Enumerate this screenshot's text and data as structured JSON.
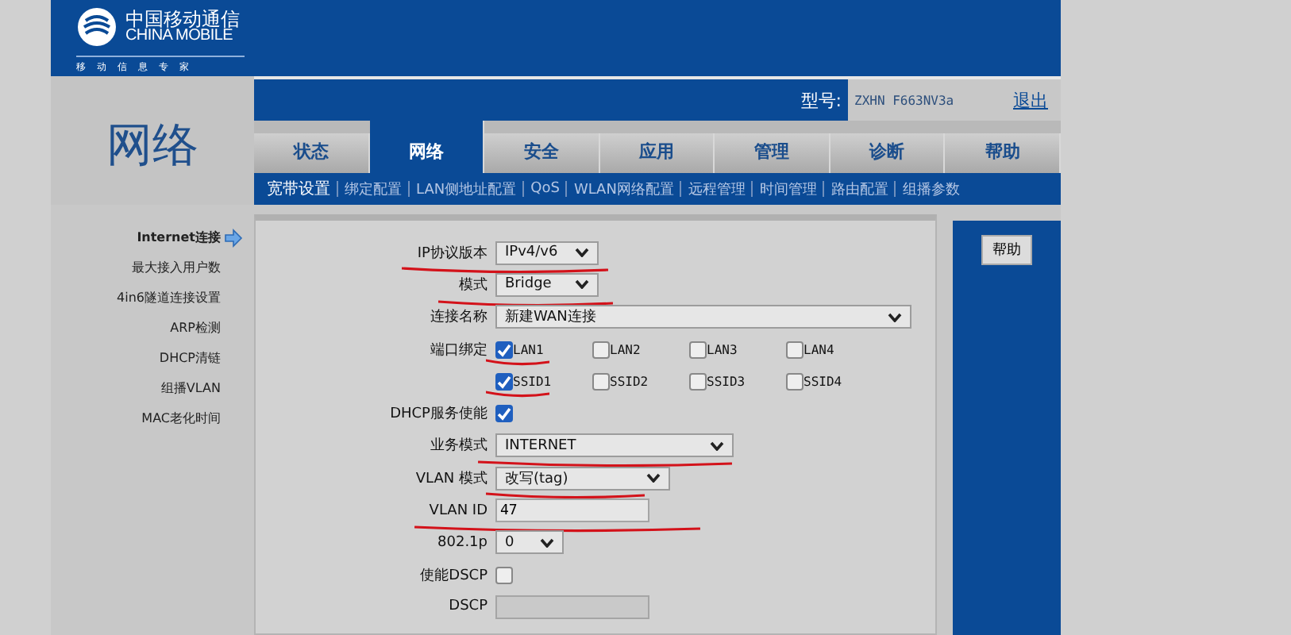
{
  "logo": {
    "name_cn": "中国移动通信",
    "name_en": "CHINA MOBILE",
    "slogan": "移动信息专家"
  },
  "section_title": "网络",
  "model": {
    "label": "型号:",
    "value": "ZXHN F663NV3a"
  },
  "logout": "退出",
  "tabs": [
    {
      "label": "状态",
      "selected": false
    },
    {
      "label": "网络",
      "selected": true
    },
    {
      "label": "安全",
      "selected": false
    },
    {
      "label": "应用",
      "selected": false
    },
    {
      "label": "管理",
      "selected": false
    },
    {
      "label": "诊断",
      "selected": false
    },
    {
      "label": "帮助",
      "selected": false
    }
  ],
  "subnav": [
    {
      "label": "宽带设置",
      "selected": true
    },
    {
      "label": "绑定配置",
      "selected": false
    },
    {
      "label": "LAN侧地址配置",
      "selected": false
    },
    {
      "label": "QoS",
      "selected": false
    },
    {
      "label": "WLAN网络配置",
      "selected": false
    },
    {
      "label": "远程管理",
      "selected": false
    },
    {
      "label": "时间管理",
      "selected": false
    },
    {
      "label": "路由配置",
      "selected": false
    },
    {
      "label": "组播参数",
      "selected": false
    }
  ],
  "sidebar": [
    {
      "label": "Internet连接",
      "selected": true
    },
    {
      "label": "最大接入用户数",
      "selected": false
    },
    {
      "label": "4in6隧道连接设置",
      "selected": false
    },
    {
      "label": "ARP检测",
      "selected": false
    },
    {
      "label": "DHCP清链",
      "selected": false
    },
    {
      "label": "组播VLAN",
      "selected": false
    },
    {
      "label": "MAC老化时间",
      "selected": false
    }
  ],
  "form": [
    {
      "kind": "select",
      "label": "IP协议版本",
      "value": "IPv4/v6",
      "underlined": true
    },
    {
      "kind": "select",
      "label": "模式",
      "value": "Bridge",
      "underlined": true
    },
    {
      "kind": "select",
      "label": "连接名称",
      "value": "新建WAN连接",
      "underlined": false
    },
    {
      "kind": "checkboxes",
      "label": "端口绑定",
      "items": [
        {
          "label": "LAN1",
          "checked": true,
          "underlined": true
        },
        {
          "label": "LAN2",
          "checked": false,
          "underlined": false
        },
        {
          "label": "LAN3",
          "checked": false,
          "underlined": false
        },
        {
          "label": "LAN4",
          "checked": false,
          "underlined": false
        }
      ]
    },
    {
      "kind": "checkboxes",
      "items": [
        {
          "label": "SSID1",
          "checked": true,
          "underlined": true
        },
        {
          "label": "SSID2",
          "checked": false,
          "underlined": false
        },
        {
          "label": "SSID3",
          "checked": false,
          "underlined": false
        },
        {
          "label": "SSID4",
          "checked": false,
          "underlined": false
        }
      ]
    },
    {
      "kind": "checkbox",
      "label": "DHCP服务使能",
      "checked": true,
      "underlined": false
    },
    {
      "kind": "select",
      "label": "业务模式",
      "value": "INTERNET",
      "underlined": true
    },
    {
      "kind": "select",
      "label": "VLAN 模式",
      "value": "改写(tag)",
      "underlined": true
    },
    {
      "kind": "text",
      "label": "VLAN ID",
      "value": "47",
      "disabled": false,
      "underlined": true
    },
    {
      "kind": "select",
      "label": "802.1p",
      "value": "0",
      "underlined": false
    },
    {
      "kind": "checkbox",
      "label": "使能DSCP",
      "checked": false,
      "underlined": false
    },
    {
      "kind": "text",
      "label": "DSCP",
      "disabled": true,
      "underlined": false
    }
  ],
  "help_button": "帮助"
}
